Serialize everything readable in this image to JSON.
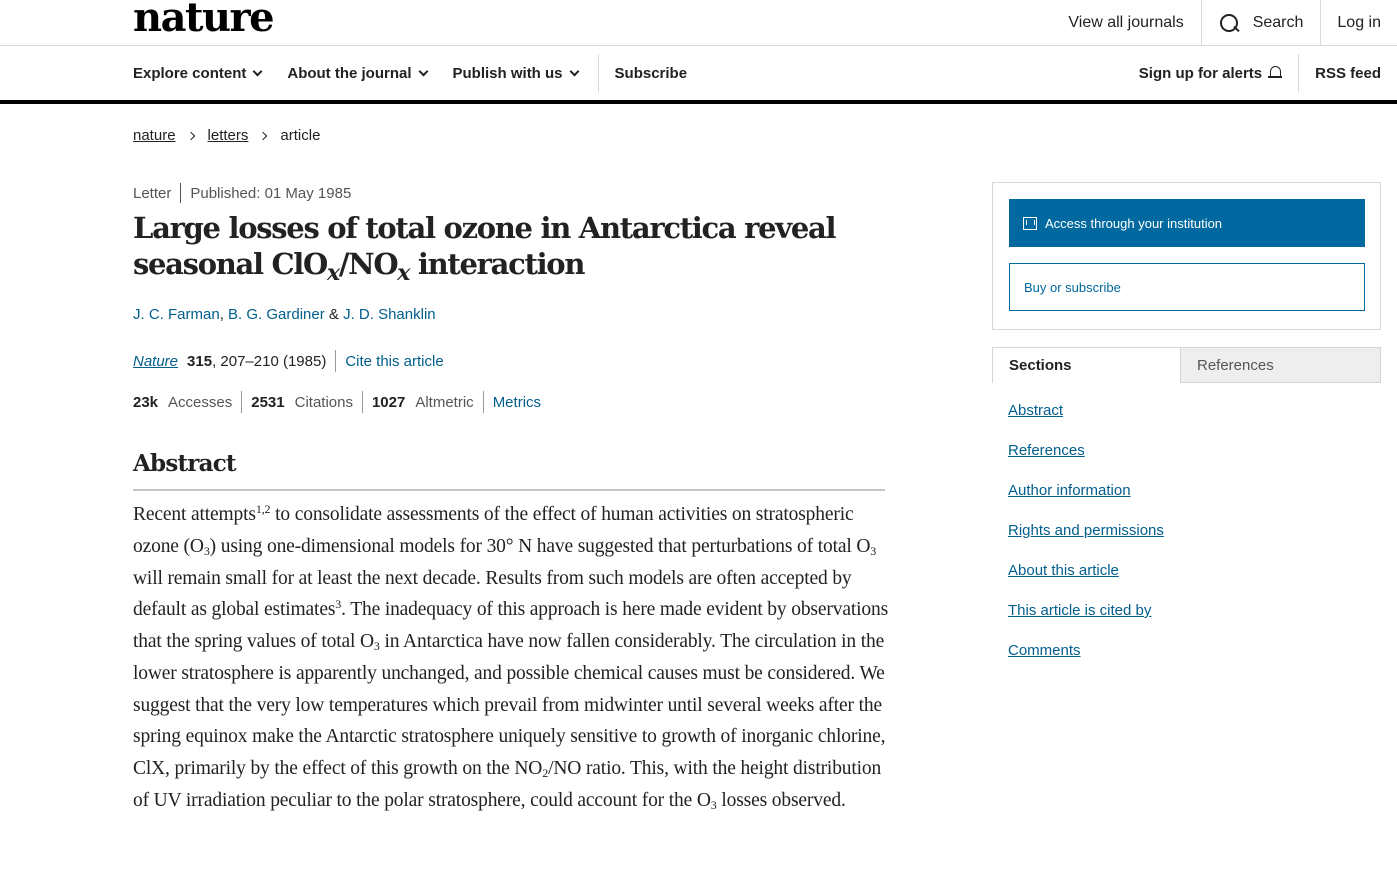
{
  "header": {
    "logo": "nature",
    "view_all": "View all journals",
    "search": "Search",
    "login": "Log in"
  },
  "nav": {
    "explore": "Explore content",
    "about": "About the journal",
    "publish": "Publish with us",
    "subscribe": "Subscribe",
    "alerts": "Sign up for alerts",
    "rss": "RSS feed"
  },
  "breadcrumb": [
    "nature",
    "letters",
    "article"
  ],
  "article": {
    "type": "Letter",
    "published": "Published: 01 May 1985",
    "title_main": "Large losses of total ozone in Antarctica reveal seasonal ClO",
    "title_sub1": "x",
    "title_mid": "/NO",
    "title_sub2": "x",
    "title_end": " interaction",
    "authors": [
      "J. C. Farman",
      "B. G. Gardiner",
      "J. D. Shanklin"
    ],
    "author_sep1": ", ",
    "author_sep2": " & ",
    "journal": "Nature",
    "volume": "315",
    "pages": ", 207–210 (1985)",
    "cite": "Cite this article",
    "metrics": {
      "accesses_value": "23k",
      "accesses_label": "Accesses",
      "citations_value": "2531",
      "citations_label": "Citations",
      "altmetric_value": "1027",
      "altmetric_label": "Altmetric",
      "metrics_link": "Metrics"
    }
  },
  "abstract": {
    "heading": "Abstract",
    "t1": "Recent attempts",
    "s1": "1,2",
    "t2": " to consolidate assessments of the effect of human activities on stratospheric ozone (O",
    "b1": "3",
    "t3": ") using one-dimensional models for 30° N have suggested that perturbations of total O",
    "b2": "3",
    "t4": " will remain small for at least the next decade. Results from such models are often accepted by default as global estimates",
    "s2": "3",
    "t5": ". The inadequacy of this approach is here made evident by observations that the spring values of total O",
    "b3": "3",
    "t6": " in Antarctica have now fallen considerably. The circulation in the lower stratosphere is apparently unchanged, and possible chemical causes must be considered. We suggest that the very low temperatures which prevail from midwinter until several weeks after the spring equinox make the Antarctic stratosphere uniquely sensitive to growth of inorganic chlorine, ClX, primarily by the effect of this growth on the NO",
    "b4": "2",
    "t7": "/NO ratio. This, with the height distribution of UV irradiation peculiar to the polar stratosphere, could account for the O",
    "b5": "3",
    "t8": " losses observed."
  },
  "sidebar": {
    "access_btn": "Access through your institution",
    "buy_btn": "Buy or subscribe",
    "tab_sections": "Sections",
    "tab_references": "References",
    "sections": [
      "Abstract",
      "References",
      "Author information",
      "Rights and permissions",
      "About this article",
      "This article is cited by",
      "Comments"
    ]
  },
  "colors": {
    "link": "#025e8d",
    "primary_button": "#01699f"
  }
}
